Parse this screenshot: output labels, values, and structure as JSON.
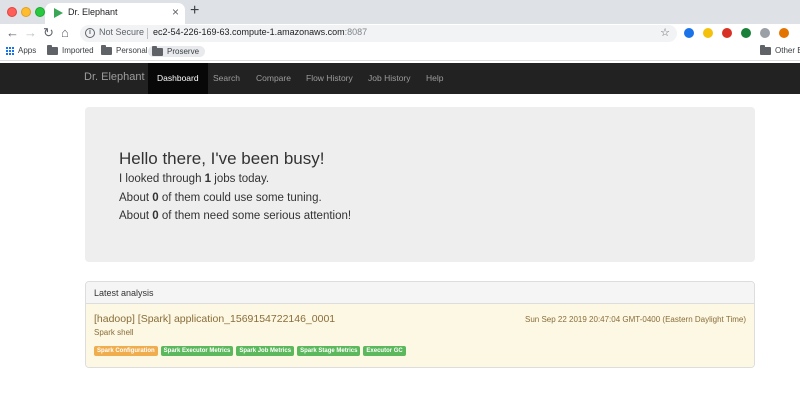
{
  "browser": {
    "tab_title": "Dr. Elephant",
    "tab_close": "×",
    "new_tab": "+",
    "back": "←",
    "forward": "→",
    "reload": "↻",
    "home": "⌂",
    "security": "Not Secure",
    "url_host": "ec2-54-226-169-63.compute-1.amazonaws.com",
    "url_port": ":8087",
    "star": "☆",
    "bookmarks": [
      "Apps",
      "Imported",
      "Personal",
      "Proserve"
    ],
    "other_bookmarks": "Other B"
  },
  "navbar": {
    "brand": "Dr. Elephant",
    "items": [
      "Dashboard",
      "Search",
      "Compare",
      "Flow History",
      "Job History",
      "Help"
    ],
    "active": "Dashboard"
  },
  "jumbotron": {
    "title": "Hello there, I've been busy!",
    "line1_pre": "I looked through ",
    "line1_num": "1",
    "line1_post": " jobs today.",
    "line2_pre": "About ",
    "line2_num": "0",
    "line2_post": " of them could use some tuning.",
    "line3_pre": "About ",
    "line3_num": "0",
    "line3_post": " of them need some serious attention!"
  },
  "analysis": {
    "title": "Latest analysis",
    "job_title": "[hadoop] [Spark] application_1569154722146_0001",
    "job_name": "Spark shell",
    "time": "Sun Sep 22 2019 20:47:04 GMT-0400 (Eastern Daylight Time)",
    "labels": [
      {
        "text": "Spark Configuration",
        "color": "#f0ad4e"
      },
      {
        "text": "Spark Executor Metrics",
        "color": "#5cb85c"
      },
      {
        "text": "Spark Job Metrics",
        "color": "#5cb85c"
      },
      {
        "text": "Spark Stage Metrics",
        "color": "#5cb85c"
      },
      {
        "text": "Executor GC",
        "color": "#5cb85c"
      }
    ]
  }
}
